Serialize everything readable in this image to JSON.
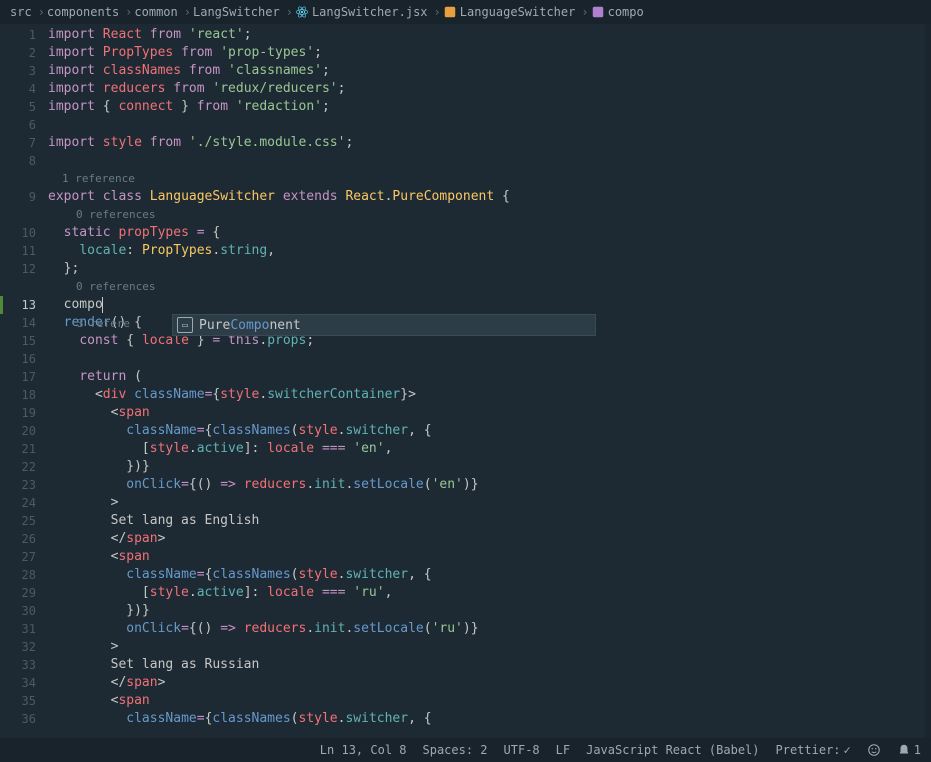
{
  "breadcrumb": {
    "items": [
      "src",
      "components",
      "common",
      "LangSwitcher",
      "LangSwitcher.jsx",
      "LanguageSwitcher",
      "compo"
    ]
  },
  "codelens": {
    "one_ref": "1 reference",
    "zero_ref": "0 references",
    "three_ref_prefix": "3 refere"
  },
  "suggest": {
    "prefix": "Pure",
    "highlight": "Compo",
    "suffix": "nent"
  },
  "lines": {
    "typed": "compo",
    "set_en": "        Set lang as English",
    "set_ru": "        Set lang as Russian"
  },
  "tokens": {
    "import": "import",
    "export": "export",
    "class": "class",
    "extends": "extends",
    "static": "static",
    "from": "from",
    "const": "const",
    "return": "return",
    "this": "this",
    "React": "React",
    "PropTypes": "PropTypes",
    "classNames": "classNames",
    "reducers": "reducers",
    "connect": "connect",
    "style": "style",
    "LanguageSwitcher": "LanguageSwitcher",
    "PureComponent": "PureComponent",
    "propTypes": "propTypes",
    "locale": "locale",
    "string": "string",
    "render": "render",
    "props": "props",
    "div": "div",
    "span": "span",
    "className": "className",
    "switcherContainer": "switcherContainer",
    "switcher": "switcher",
    "active": "active",
    "onClick": "onClick",
    "init": "init",
    "setLocale": "setLocale",
    "react_str": "'react'",
    "proptypes_str": "'prop-types'",
    "classnames_str": "'classnames'",
    "reduxreducers_str": "'redux/reducers'",
    "redaction_str": "'redaction'",
    "stylemodule_str": "'./style.module.css'",
    "en_str": "'en'",
    "ru_str": "'ru'"
  },
  "statusbar": {
    "position": "Ln 13, Col 8",
    "spaces": "Spaces: 2",
    "encoding": "UTF-8",
    "eol": "LF",
    "language": "JavaScript React (Babel)",
    "prettier": "Prettier:",
    "bell_count": "1"
  }
}
